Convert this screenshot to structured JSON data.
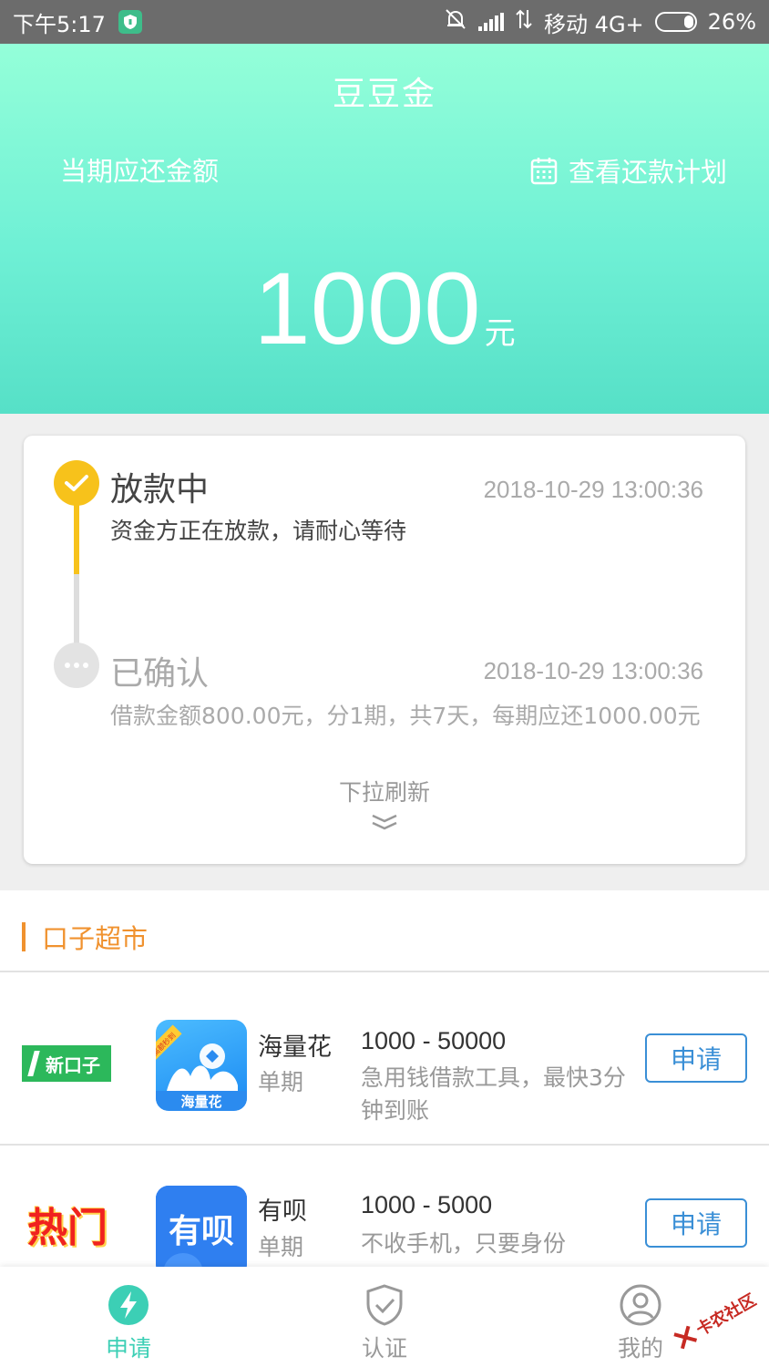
{
  "status_bar": {
    "time": "下午5:17",
    "carrier": "移动 4G+",
    "battery": "26%"
  },
  "header": {
    "title": "豆豆金",
    "due_label": "当期应还金额",
    "plan_link": "查看还款计划",
    "amount": "1000",
    "unit": "元"
  },
  "timeline": {
    "steps": [
      {
        "title": "放款中",
        "time": "2018-10-29 13:00:36",
        "desc": "资金方正在放款，请耐心等待"
      },
      {
        "title": "已确认",
        "time": "2018-10-29 13:00:36",
        "desc": "借款金额800.00元，分1期，共7天，每期应还1000.00元"
      }
    ],
    "pull_refresh": "下拉刷新"
  },
  "market": {
    "title": "口子超市",
    "items": [
      {
        "badge": "新口子",
        "icon_text": "海量花",
        "icon_tag": "高额秒到",
        "name": "海量花",
        "type": "单期",
        "range": "1000 - 50000",
        "desc": "急用钱借款工具，最快3分钟到账",
        "button": "申请"
      },
      {
        "badge": "热门",
        "icon_text": "有呗",
        "name": "有呗",
        "type": "单期",
        "range": "1000 - 5000",
        "desc": "不收手机，只要身份",
        "button": "申请"
      }
    ]
  },
  "nav": {
    "apply": "申请",
    "verify": "认证",
    "mine": "我的"
  },
  "watermark": "卡农社区",
  "colors": {
    "accent": "#3ccfb5",
    "timeline_active": "#f7c21b",
    "market_accent": "#f0922f",
    "button_blue": "#3a8fd6"
  }
}
